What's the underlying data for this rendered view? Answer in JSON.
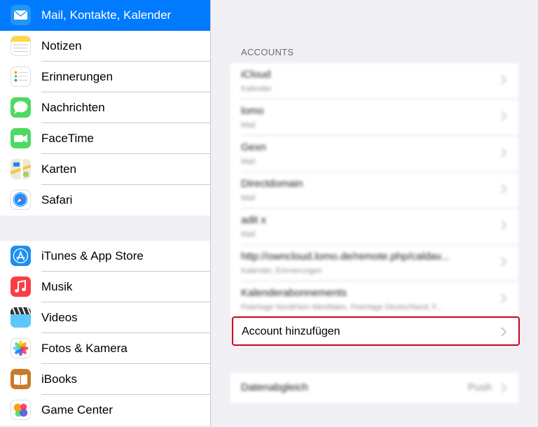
{
  "sidebar": {
    "group1": [
      {
        "label": "Mail, Kontakte, Kalender",
        "icon": "mail-icon",
        "color": "#1e88f5"
      },
      {
        "label": "Notizen",
        "icon": "notes-icon",
        "color": "#ffd83a"
      },
      {
        "label": "Erinnerungen",
        "icon": "reminders-icon",
        "color": "#ffffff"
      },
      {
        "label": "Nachrichten",
        "icon": "messages-icon",
        "color": "#4cd964"
      },
      {
        "label": "FaceTime",
        "icon": "facetime-icon",
        "color": "#4cd964"
      },
      {
        "label": "Karten",
        "icon": "maps-icon",
        "color": "#9fd06b"
      },
      {
        "label": "Safari",
        "icon": "safari-icon",
        "color": "#1a8cff"
      }
    ],
    "group2": [
      {
        "label": "iTunes & App Store",
        "icon": "app-store-icon",
        "color": "#1f8ef1"
      },
      {
        "label": "Musik",
        "icon": "music-icon",
        "color": "#fc3c44"
      },
      {
        "label": "Videos",
        "icon": "videos-icon",
        "color": "#5ac8fa"
      },
      {
        "label": "Fotos & Kamera",
        "icon": "photos-icon",
        "color": "#ffffff"
      },
      {
        "label": "iBooks",
        "icon": "ibooks-icon",
        "color": "#e08a2b"
      },
      {
        "label": "Game Center",
        "icon": "game-center-icon",
        "color": "#ffffff"
      }
    ],
    "selected_color": "#007aff"
  },
  "detail": {
    "section_header": "ACCOUNTS",
    "accounts": [
      {
        "title": "iCloud",
        "subtitle": "Kalender"
      },
      {
        "title": "lomo",
        "subtitle": "Mail"
      },
      {
        "title": "Gexn",
        "subtitle": "Mail"
      },
      {
        "title": "Directdomain",
        "subtitle": "Mail"
      },
      {
        "title": "adit x",
        "subtitle": "Mail"
      },
      {
        "title": "http://owncloud.lomo.de/remote.php/caldav...",
        "subtitle": "Kalender, Erinnerungen"
      },
      {
        "title": "Kalenderabonnements",
        "subtitle": "Feiertage Nordrhein-Westfalen, Feiertage Deutschland, F..."
      }
    ],
    "add_account": "Account hinzufügen",
    "sync_label": "Datenabgleich",
    "sync_value": "Push",
    "highlight_color": "#d0021b"
  }
}
